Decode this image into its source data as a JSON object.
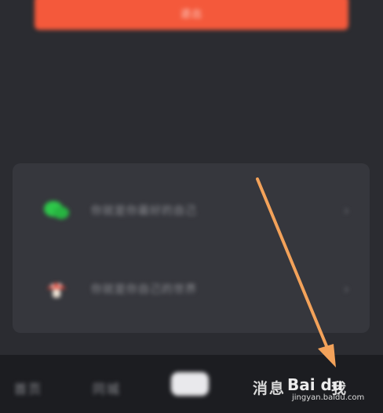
{
  "top_button": {
    "label": "退出"
  },
  "card": {
    "rows": [
      {
        "label": "你就是你最好的自己",
        "icon": "wechat-icon",
        "chevron": "›"
      },
      {
        "label": "你就是你自己的世界",
        "icon": "mushroom-icon",
        "chevron": "›"
      }
    ]
  },
  "tabbar": {
    "tabs": [
      "首页",
      "同城",
      "",
      "消息",
      "我"
    ]
  },
  "watermark": {
    "logo": "Bai du",
    "url": "jingyan.baidu.com"
  },
  "colors": {
    "accent": "#f4593b",
    "arrow": "#f3a25a",
    "background": "#2b2c31"
  }
}
